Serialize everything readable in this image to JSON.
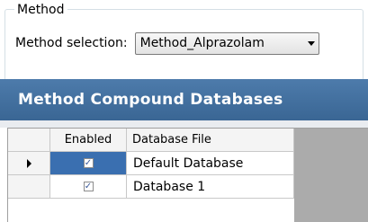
{
  "method_group": {
    "legend": "Method",
    "selection_label": "Method selection:",
    "selected_method": "Method_Alprazolam"
  },
  "banner": {
    "title": "Method Compound Databases"
  },
  "grid": {
    "columns": [
      "Enabled",
      "Database File"
    ],
    "rows": [
      {
        "enabled": true,
        "file": "Default  Database",
        "current": true
      },
      {
        "enabled": true,
        "file": "Database 1",
        "current": false
      }
    ]
  },
  "colors": {
    "banner": "#3f6d9c",
    "selected_cell": "#3a6fb0",
    "grid_empty_area": "#ababab"
  }
}
